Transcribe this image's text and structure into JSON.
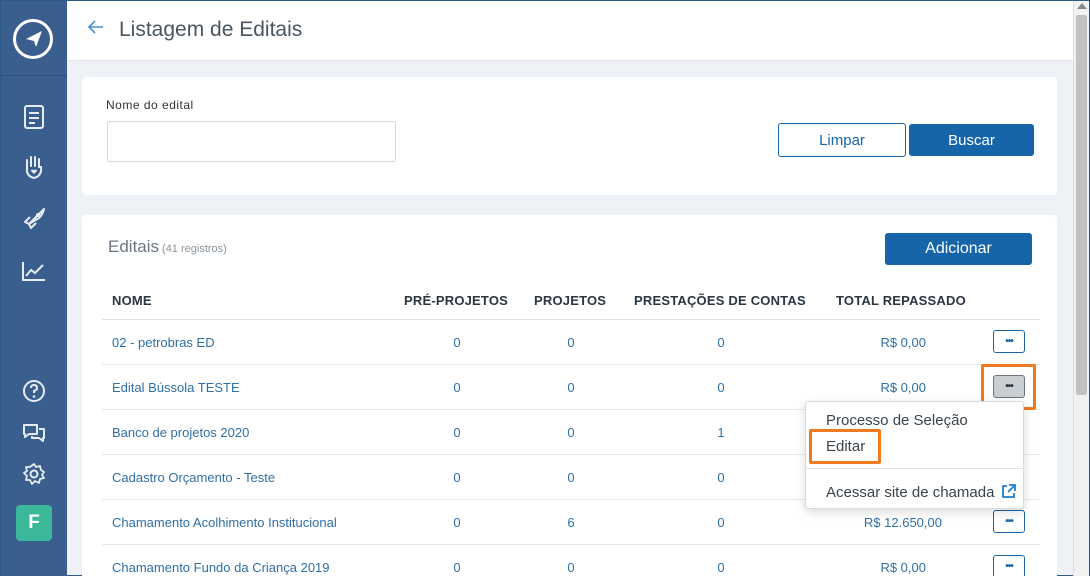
{
  "header": {
    "title": "Listagem de Editais"
  },
  "sidebar": {
    "icons": [
      "compass-logo-icon",
      "document-icon",
      "hand-heart-icon",
      "rocket-icon",
      "chart-icon",
      "help-icon",
      "chat-icon",
      "gear-icon"
    ],
    "avatar_letter": "F",
    "avatar_color": "#3bb89a"
  },
  "filter": {
    "field_label": "Nome do edital",
    "field_value": "",
    "clear_label": "Limpar",
    "search_label": "Buscar"
  },
  "list": {
    "title": "Editais",
    "count": "(41 registros)",
    "add_label": "Adicionar",
    "columns": [
      "NOME",
      "PRÉ-PROJETOS",
      "PROJETOS",
      "PRESTAÇÕES DE CONTAS",
      "TOTAL REPASSADO"
    ],
    "rows": [
      {
        "name": "02 - petrobras ED",
        "pre": "0",
        "proj": "0",
        "prest": "0",
        "total": "R$ 0,00",
        "more": "•••"
      },
      {
        "name": "Edital Bússola TESTE",
        "pre": "0",
        "proj": "0",
        "prest": "0",
        "total": "R$ 0,00",
        "more": "•••"
      },
      {
        "name": "Banco de projetos 2020",
        "pre": "0",
        "proj": "0",
        "prest": "1",
        "total": "",
        "more": "•••"
      },
      {
        "name": "Cadastro Orçamento - Teste",
        "pre": "0",
        "proj": "0",
        "prest": "0",
        "total": "",
        "more": "•••"
      },
      {
        "name": "Chamamento Acolhimento Institucional",
        "pre": "0",
        "proj": "6",
        "prest": "0",
        "total": "R$ 12.650,00",
        "more": "•••"
      },
      {
        "name": "Chamamento Fundo da Criança 2019",
        "pre": "0",
        "proj": "0",
        "prest": "0",
        "total": "R$ 0,00",
        "more": "•••"
      }
    ]
  },
  "dropdown": {
    "items": [
      "Processo de Seleção",
      "Editar",
      "Acessar site de chamada"
    ]
  },
  "colors": {
    "accent": "#1565a8",
    "highlight": "#f07a20",
    "sidebar": "#3a5f8f"
  }
}
